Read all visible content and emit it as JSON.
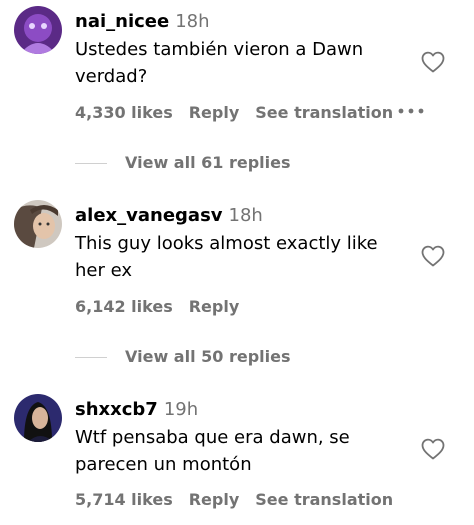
{
  "comments": [
    {
      "username": "nai_nicee",
      "time": "18h",
      "text": "Ustedes también vieron a Dawn verdad?",
      "likes": "4,330 likes",
      "reply": "Reply",
      "translation": "See translation",
      "view_replies": "View all 61 replies",
      "avatar_color": "#5b2a86"
    },
    {
      "username": "alex_vanegasv",
      "time": "18h",
      "text": "This guy looks almost exactly like her ex",
      "likes": "6,142 likes",
      "reply": "Reply",
      "view_replies": "View all 50 replies",
      "avatar_color": "#8a8580"
    },
    {
      "username": "shxxcb7",
      "time": "19h",
      "text": "Wtf pensaba que era dawn, se parecen un montón",
      "likes": "5,714 likes",
      "reply": "Reply",
      "translation": "See translation",
      "avatar_color": "#2c2a6e"
    }
  ],
  "icons": {
    "like": "heart-outline-icon",
    "more": "more-horizontal-icon"
  },
  "colors": {
    "secondary_text": "#737373",
    "primary_text": "#000000"
  }
}
